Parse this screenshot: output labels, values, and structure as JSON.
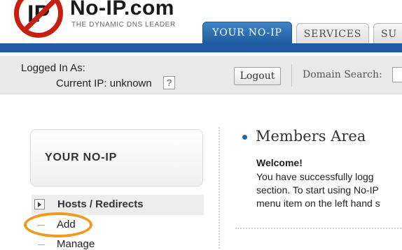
{
  "header": {
    "brand": "No-IP.com",
    "tagline": "THE DYNAMIC DNS LEADER",
    "logo_text": "IP",
    "tabs": [
      {
        "label": "YOUR NO-IP",
        "active": true
      },
      {
        "label": "SERVICES",
        "active": false
      },
      {
        "label": "SU",
        "active": false
      }
    ]
  },
  "account_bar": {
    "logged_in_label": "Logged In As:",
    "current_ip_label": "Current IP: unknown",
    "help_symbol": "?",
    "logout_label": "Logout",
    "domain_search_label": "Domain Search:"
  },
  "sidebar": {
    "panel_title": "YOUR NO-IP",
    "section_label": "Hosts / Redirects",
    "items": [
      {
        "label": "Add",
        "highlighted": true
      },
      {
        "label": "Manage",
        "highlighted": false
      }
    ]
  },
  "main": {
    "title": "Members Area",
    "welcome": "Welcome!",
    "lines": [
      "You have successfully logg",
      "section. To start using No-IP",
      "menu item on the left hand s"
    ]
  },
  "colors": {
    "tab_active": "#1d5a9e",
    "tab_bar": "#1f5ba5",
    "logo_red": "#c81e12",
    "highlight_orange": "#f29a1d"
  }
}
